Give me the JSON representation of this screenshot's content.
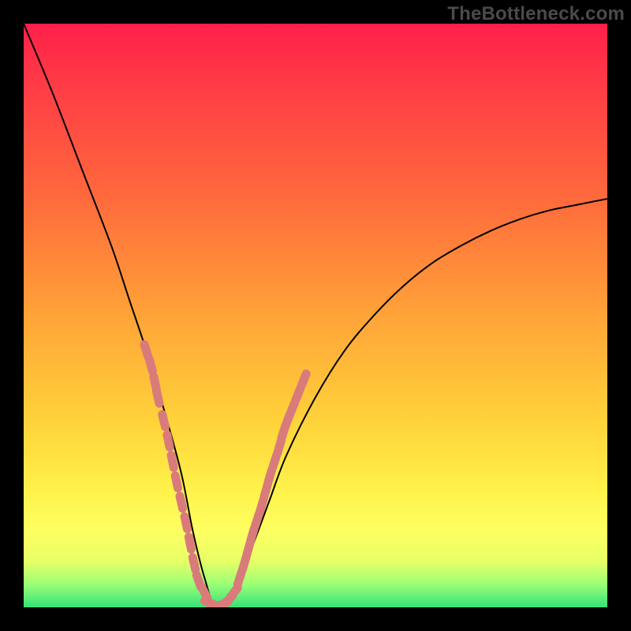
{
  "watermark": "TheBottleneck.com",
  "chart_data": {
    "type": "line",
    "title": "",
    "xlabel": "",
    "ylabel": "",
    "xlim": [
      0,
      100
    ],
    "ylim": [
      0,
      100
    ],
    "grid": false,
    "legend": false,
    "description": "Bottleneck curve over gradient background; minimum near x≈33 at y≈0; steep left branch from top-left, shallow right branch rising toward ~70% height at right edge.",
    "series": [
      {
        "name": "curve",
        "x": [
          0,
          5,
          10,
          15,
          18,
          21,
          24,
          27,
          29,
          31,
          33,
          36,
          39,
          42,
          45,
          50,
          55,
          60,
          65,
          70,
          75,
          80,
          85,
          90,
          95,
          100
        ],
        "y": [
          100,
          88,
          75,
          62,
          53,
          44,
          34,
          23,
          13,
          5,
          0,
          3,
          10,
          18,
          26,
          36,
          44,
          50,
          55,
          59,
          62,
          64.5,
          66.5,
          68,
          69,
          70
        ]
      }
    ],
    "markers": [
      {
        "name": "dotted-left",
        "color": "#d97b7b",
        "points_xy": [
          [
            21.0,
            44.0
          ],
          [
            21.8,
            41.5
          ],
          [
            22.5,
            38.5
          ],
          [
            23.0,
            36.0
          ],
          [
            24.0,
            32.0
          ],
          [
            24.8,
            28.5
          ],
          [
            25.5,
            25.0
          ],
          [
            26.2,
            21.5
          ],
          [
            27.0,
            18.0
          ],
          [
            27.8,
            14.5
          ],
          [
            28.5,
            11.0
          ],
          [
            29.2,
            7.5
          ],
          [
            30.0,
            4.5
          ],
          [
            31.0,
            2.5
          ]
        ]
      },
      {
        "name": "dotted-bottom",
        "color": "#d97b7b",
        "points_xy": [
          [
            32.0,
            0.7
          ],
          [
            33.0,
            0.3
          ],
          [
            34.0,
            0.5
          ],
          [
            35.0,
            1.2
          ],
          [
            36.0,
            2.5
          ]
        ]
      },
      {
        "name": "dotted-right",
        "color": "#d97b7b",
        "points_xy": [
          [
            37.0,
            5.0
          ],
          [
            37.8,
            7.5
          ],
          [
            38.5,
            10.0
          ],
          [
            39.2,
            12.5
          ],
          [
            40.0,
            15.0
          ],
          [
            40.8,
            17.5
          ],
          [
            41.5,
            20.0
          ],
          [
            42.2,
            22.5
          ],
          [
            43.0,
            25.0
          ],
          [
            43.8,
            27.5
          ],
          [
            44.5,
            30.0
          ],
          [
            45.2,
            32.0
          ],
          [
            46.0,
            34.0
          ],
          [
            47.0,
            36.5
          ],
          [
            48.0,
            39.0
          ]
        ]
      }
    ]
  }
}
